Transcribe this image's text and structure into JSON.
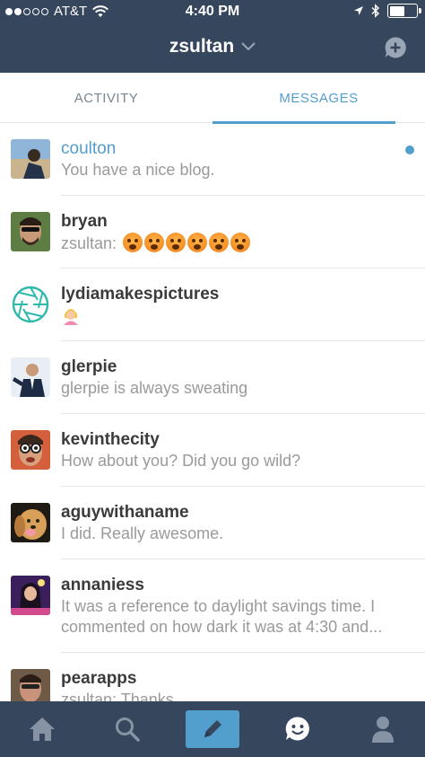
{
  "status_bar": {
    "carrier": "AT&T",
    "time": "4:40 PM",
    "signal_bars_filled": 2,
    "signal_bars_total": 5,
    "battery_level": 0.58
  },
  "nav": {
    "title": "zsultan",
    "dropdown_icon": "chevron-down-icon",
    "action_icon": "new-message-icon"
  },
  "tabs": [
    {
      "label": "ACTIVITY",
      "active": false
    },
    {
      "label": "MESSAGES",
      "active": true
    }
  ],
  "conversations": [
    {
      "name": "coulton",
      "message": "You have a nice blog.",
      "unread": true
    },
    {
      "name": "bryan",
      "message": "zsultan:",
      "emoji_count": 6
    },
    {
      "name": "lydiamakespictures",
      "message": "",
      "emoji": "person-emoji"
    },
    {
      "name": "glerpie",
      "message": "glerpie is always sweating"
    },
    {
      "name": "kevinthecity",
      "message": "How about you? Did you go wild?"
    },
    {
      "name": "aguywithaname",
      "message": "I did. Really awesome."
    },
    {
      "name": "annaniess",
      "message": "It was a reference to daylight savings time. I commented on how dark it was at 4:30 and..."
    },
    {
      "name": "pearapps",
      "message": "zsultan: Thanks"
    }
  ],
  "tabbar": [
    "home-icon",
    "search-icon",
    "compose-icon",
    "messaging-icon",
    "account-icon"
  ],
  "colors": {
    "navy": "#36465d",
    "accent": "#529ecc",
    "muted_text": "#9a9a9a"
  }
}
